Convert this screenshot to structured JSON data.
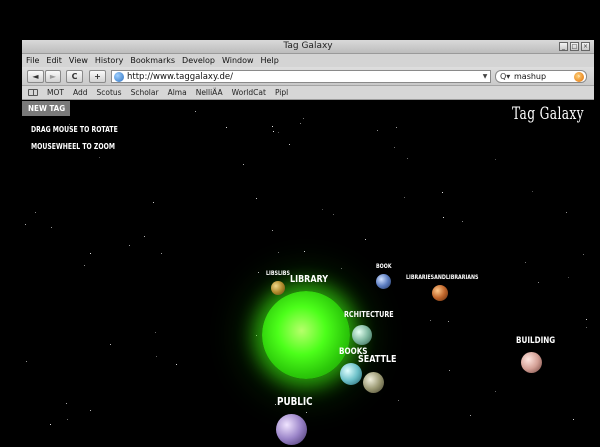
{
  "window": {
    "title": "Tag Galaxy"
  },
  "menu": [
    "File",
    "Edit",
    "View",
    "History",
    "Bookmarks",
    "Develop",
    "Window",
    "Help"
  ],
  "nav": {
    "back": "◄",
    "forward": "►",
    "reload": "C",
    "add": "+",
    "url": "http://www.taggalaxy.de/",
    "search_value": "mashup"
  },
  "bookmarks": [
    "MOT",
    "Add",
    "Scotus",
    "Scholar",
    "Alma",
    "NelliÄA",
    "WorldCat",
    "Pipl"
  ],
  "content": {
    "new_tag_label": "NEW TAG",
    "hint_rotate": "DRAG MOUSE TO ROTATE",
    "hint_zoom": "MOUSEWHEEL TO ZOOM",
    "logo": "Tag Galaxy"
  },
  "tags": {
    "libslibs": "LIBSLIBS",
    "library": "LIBRARY",
    "book": "BOOK",
    "librariesandlibrarians": "LIBRARIESANDLIBRARIANS",
    "architecture": "RCHITECTURE",
    "books": "BOOKS",
    "seattle": "SEATTLE",
    "building": "BUILDING",
    "public": "PUBLIC"
  },
  "colors": {
    "sun": "#4cff1a",
    "accent_bar": "#7a7a7a"
  }
}
